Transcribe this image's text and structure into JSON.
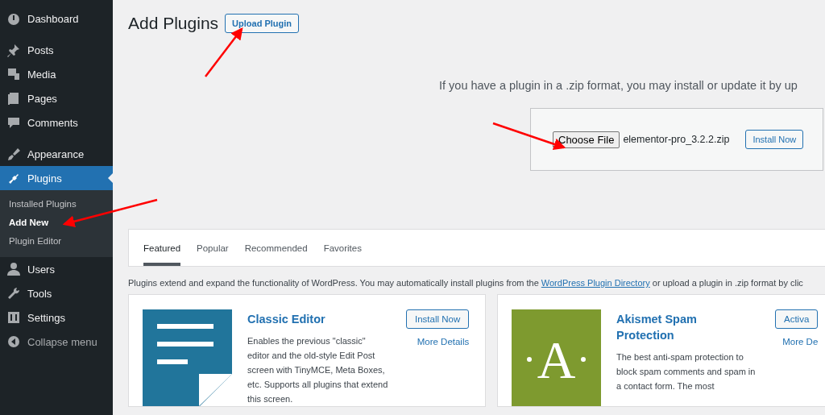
{
  "sidebar": {
    "items": [
      {
        "label": "Dashboard",
        "selected": false
      },
      {
        "label": "Posts",
        "selected": false
      },
      {
        "label": "Media",
        "selected": false
      },
      {
        "label": "Pages",
        "selected": false
      },
      {
        "label": "Comments",
        "selected": false
      },
      {
        "label": "Appearance",
        "selected": false
      },
      {
        "label": "Plugins",
        "selected": true,
        "children": [
          {
            "label": "Installed Plugins",
            "selected": false
          },
          {
            "label": "Add New",
            "selected": true
          },
          {
            "label": "Plugin Editor",
            "selected": false
          }
        ]
      },
      {
        "label": "Users",
        "selected": false
      },
      {
        "label": "Tools",
        "selected": false
      },
      {
        "label": "Settings",
        "selected": false
      },
      {
        "label": "Collapse menu",
        "selected": false
      }
    ]
  },
  "header": {
    "title": "Add Plugins",
    "button": "Upload Plugin"
  },
  "upload": {
    "help": "If you have a plugin in a .zip format, you may install or update it by up",
    "choose_button": "Choose File",
    "file_name": "elementor-pro_3.2.2.zip",
    "install_button": "Install Now"
  },
  "tabs": [
    {
      "label": "Featured",
      "selected": true
    },
    {
      "label": "Popular",
      "selected": false
    },
    {
      "label": "Recommended",
      "selected": false
    },
    {
      "label": "Favorites",
      "selected": false
    }
  ],
  "intro": {
    "before": "Plugins extend and expand the functionality of WordPress. You may automatically install plugins from the ",
    "link": "WordPress Plugin Directory",
    "after": " or upload a plugin in .zip format by clic"
  },
  "plugins": [
    {
      "name": "Classic Editor",
      "kind": "document",
      "action": "Install Now",
      "details": "More Details",
      "description": "Enables the previous \"classic\" editor and the old-style Edit Post screen with TinyMCE, Meta Boxes, etc. Supports all plugins that extend this screen."
    },
    {
      "name": "Akismet Spam Protection",
      "kind": "letter",
      "icon_letter": "A",
      "action": "Activa",
      "details": "More De",
      "description": "The best anti-spam protection to block spam comments and spam in a contact form. The most"
    }
  ]
}
